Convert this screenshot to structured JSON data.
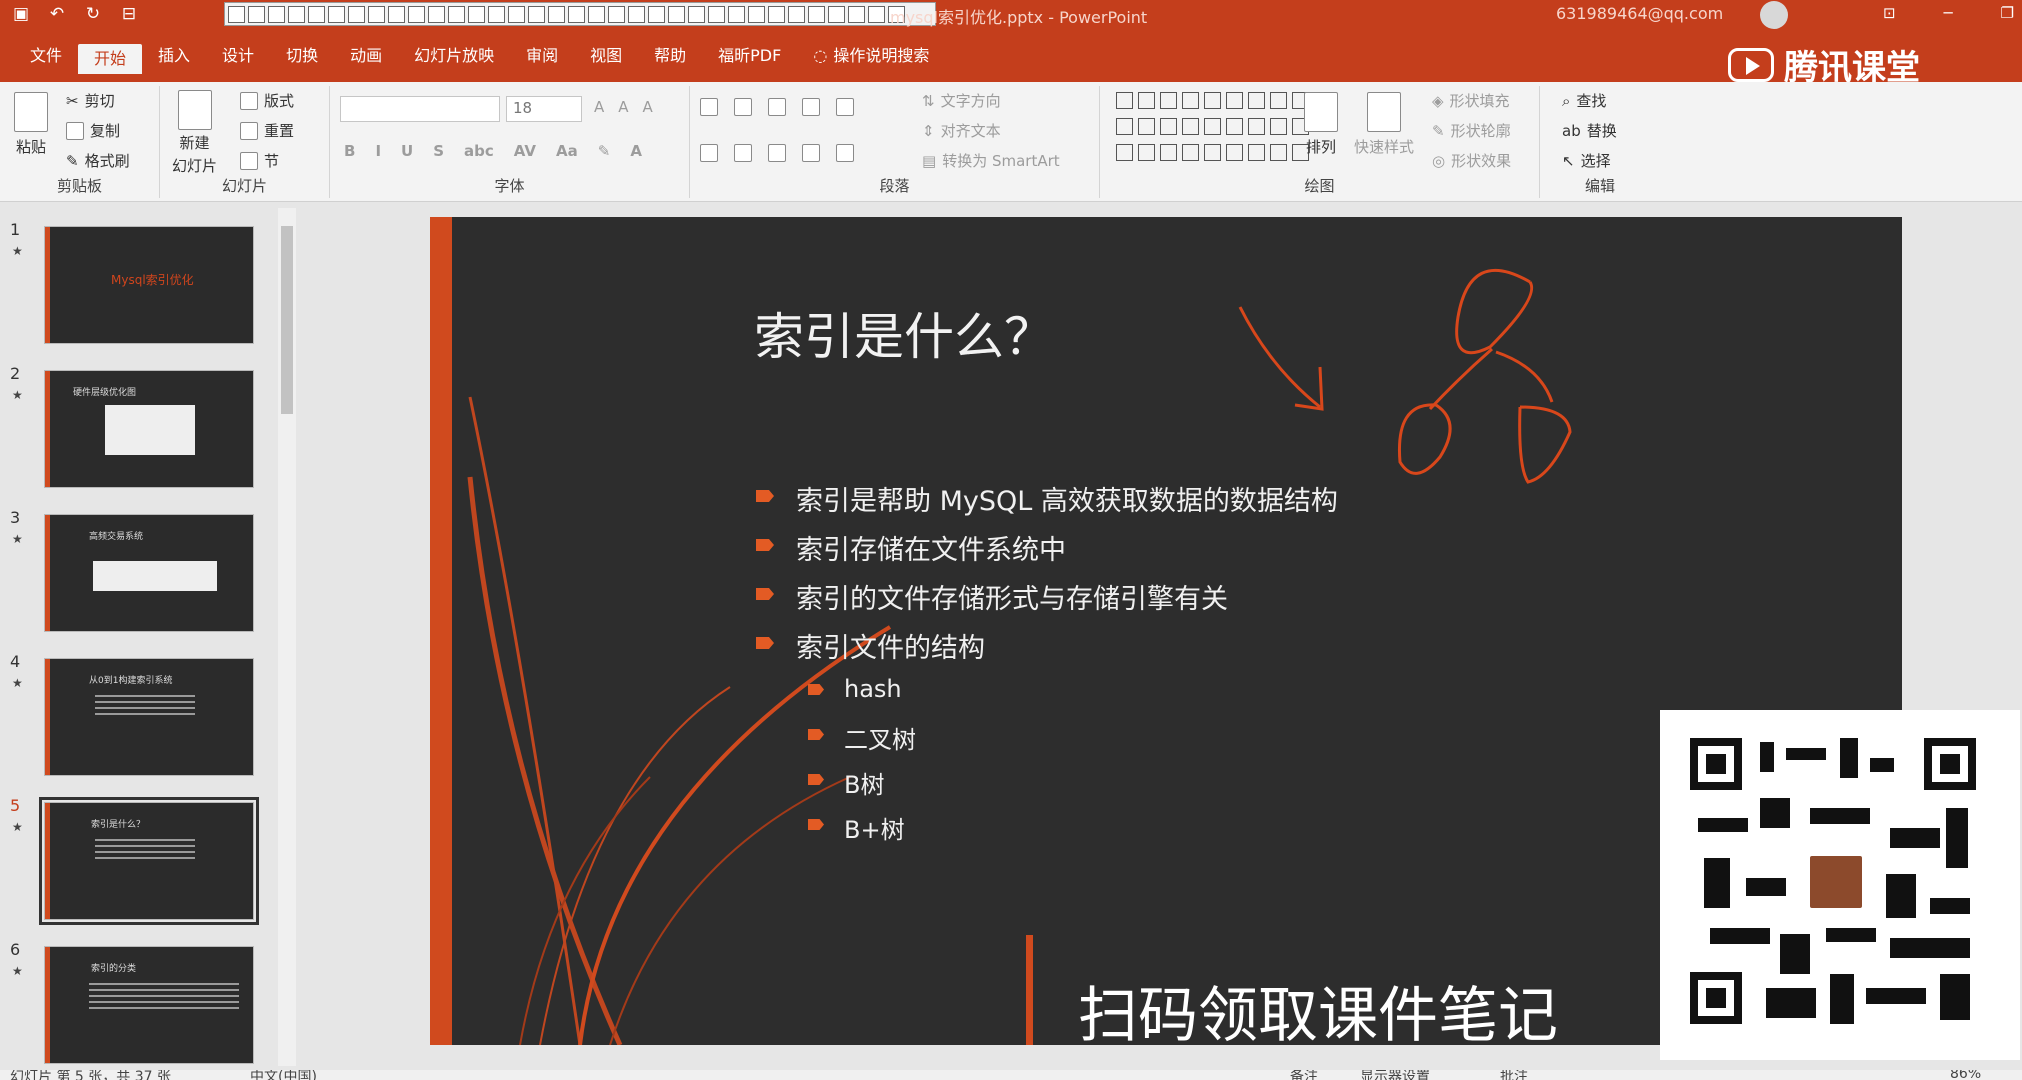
{
  "titlebar": {
    "doc_title": "mysql索引优化.pptx - PowerPoint",
    "account": "631989464@qq.com"
  },
  "tabs": [
    "文件",
    "开始",
    "插入",
    "设计",
    "切换",
    "动画",
    "幻灯片放映",
    "审阅",
    "视图",
    "帮助",
    "福昕PDF"
  ],
  "search_tab": "操作说明搜索",
  "brand": "腾讯课堂",
  "ribbon": {
    "clipboard": {
      "paste": "粘贴",
      "cut": "剪切",
      "copy": "复制",
      "format_painter": "格式刷",
      "label": "剪贴板"
    },
    "slides": {
      "new_slide": "新建",
      "new_slide_2": "幻灯片",
      "layout": "版式",
      "reset": "重置",
      "section": "节",
      "label": "幻灯片"
    },
    "font": {
      "size": "18",
      "label": "字体"
    },
    "paragraph": {
      "text_direction": "文字方向",
      "align_text": "对齐文本",
      "smartart": "转换为 SmartArt",
      "label": "段落"
    },
    "drawing": {
      "arrange": "排列",
      "quick_styles": "快速样式",
      "shape_fill": "形状填充",
      "shape_outline": "形状轮廓",
      "shape_effects": "形状效果",
      "label": "绘图"
    },
    "editing": {
      "find": "查找",
      "replace": "替换",
      "select": "选择",
      "label": "编辑"
    }
  },
  "thumbnails": [
    {
      "num": "1",
      "title": "Mysql索引优化"
    },
    {
      "num": "2",
      "title": "硬件层级优化图"
    },
    {
      "num": "3",
      "title": "高频交易系统"
    },
    {
      "num": "4",
      "title": "从0到1构建索引系统"
    },
    {
      "num": "5",
      "title": "索引是什么？"
    },
    {
      "num": "6",
      "title": "索引的分类"
    }
  ],
  "slide": {
    "title": "索引是什么？",
    "bullets": [
      "索引是帮助 MySQL 高效获取数据的数据结构",
      "索引存储在文件系统中",
      "索引的文件存储形式与存储引擎有关",
      "索引文件的结构"
    ],
    "sub_bullets": [
      "hash",
      "二叉树",
      "B树",
      "B+树"
    ],
    "promo": "扫码领取课件笔记"
  },
  "status": {
    "slide_info": "幻灯片 第 5 张，共 37 张",
    "language": "中文(中国)",
    "notes": "备注",
    "display": "显示器设置",
    "comments": "批注",
    "zoom": "86%"
  },
  "colors": {
    "accent": "#c43e1c",
    "slide_bg": "#2d2d2d",
    "bullet": "#e35b24"
  }
}
